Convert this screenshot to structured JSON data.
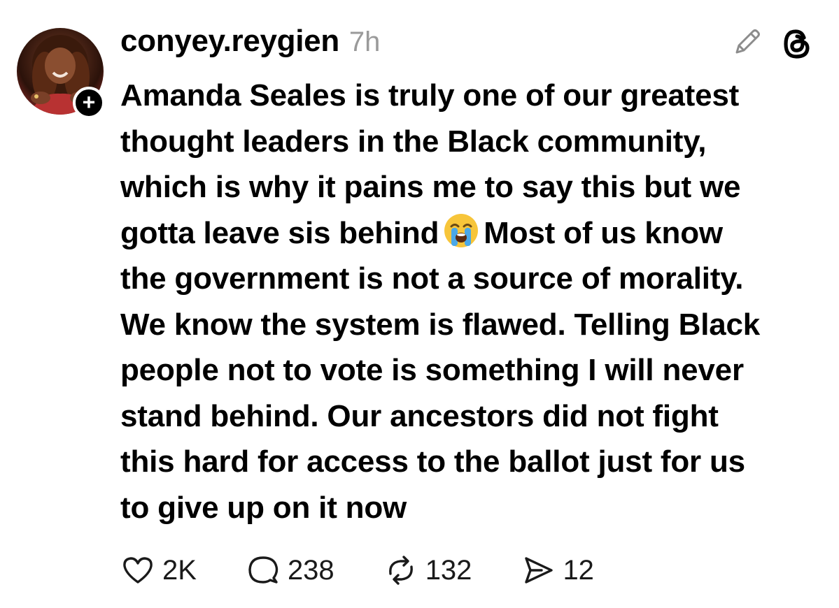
{
  "post": {
    "username": "conyey.reygien",
    "timestamp": "7h",
    "text_before_emoji": "Amanda Seales is truly one of our greatest\nthought leaders in the Black community,\nwhich is why it pains me to say this but we\ngotta leave sis behind",
    "emoji": "loudly-crying-face",
    "text_after_emoji": "Most of us know\nthe government is not a source of morality.\nWe know the system is flawed. Telling Black\npeople not to vote is something I will never\nstand behind. Our ancestors did not fight\nthis hard for access to the ballot just for us\nto give up on it now"
  },
  "actions": {
    "likes": "2K",
    "comments": "238",
    "reposts": "132",
    "shares": "12"
  },
  "icons": {
    "edit": "pencil-icon",
    "app": "threads-logo-icon",
    "follow": "plus-icon",
    "like": "heart-icon",
    "comment": "comment-bubble-icon",
    "repost": "repost-icon",
    "share": "send-icon"
  },
  "colors": {
    "text": "#000000",
    "muted": "#9a9a9a",
    "background": "#ffffff"
  }
}
